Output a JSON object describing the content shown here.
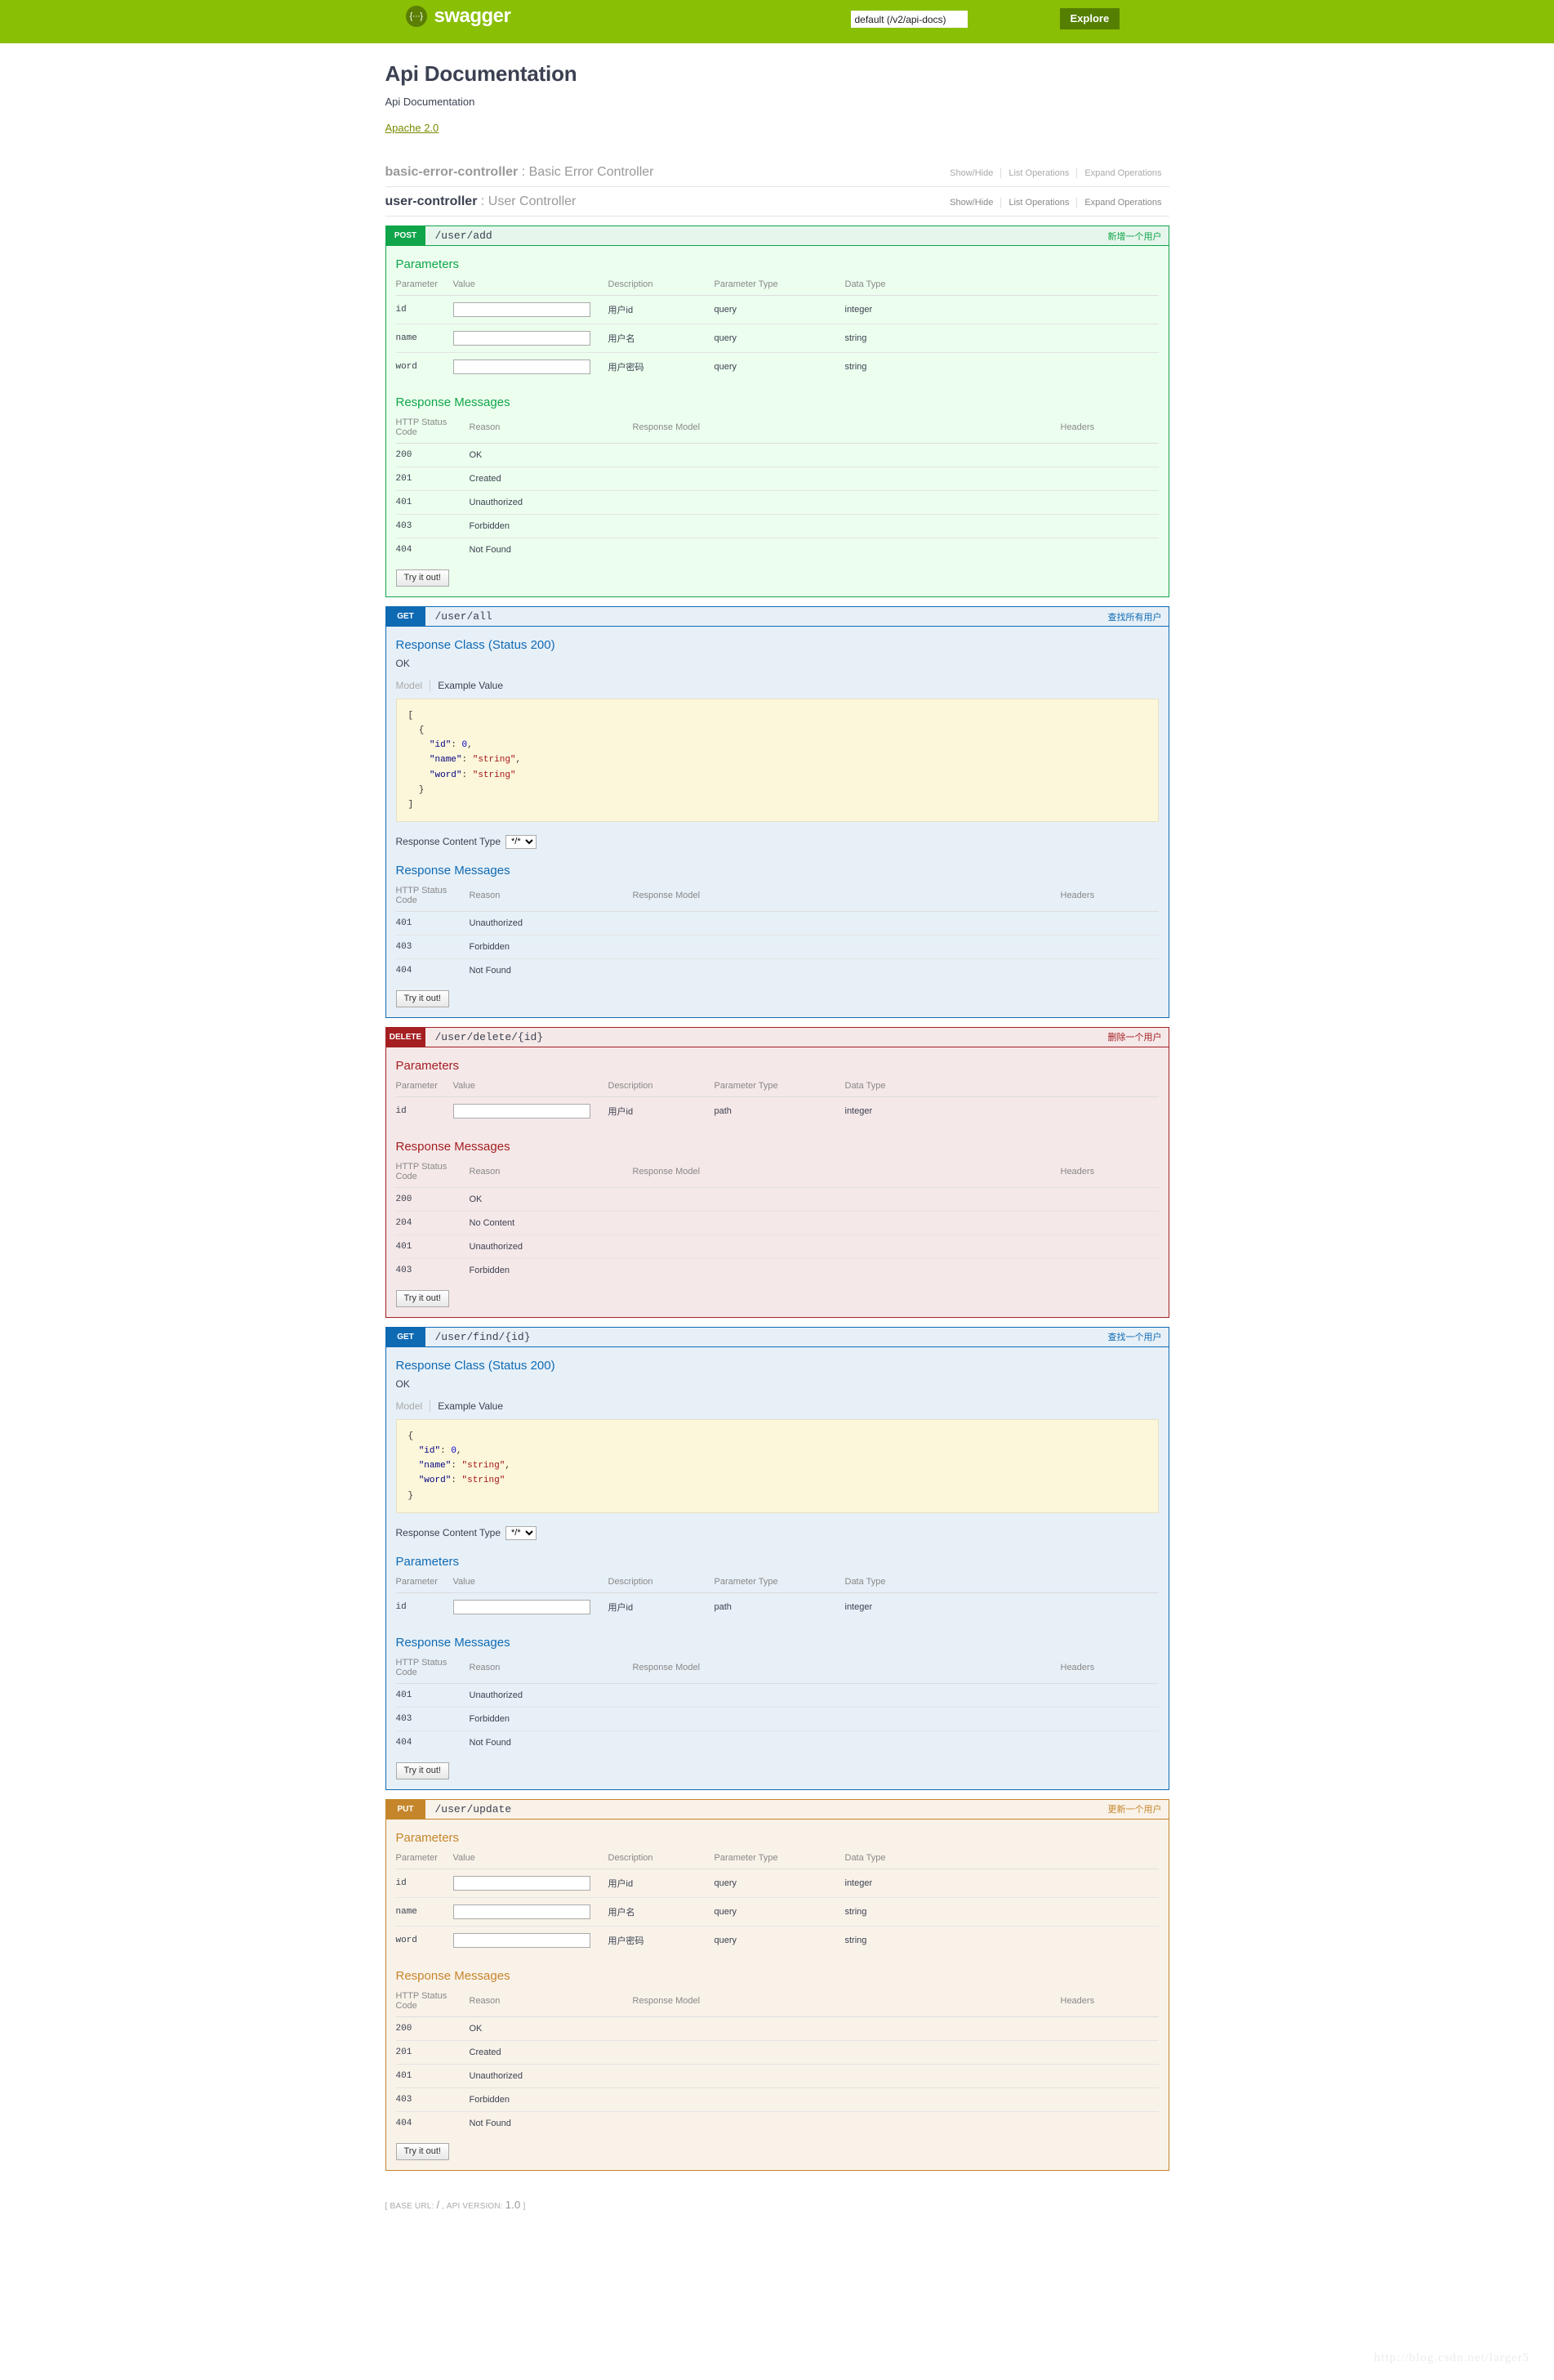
{
  "topbar": {
    "logo_text": "swagger",
    "logo_icon": "swagger-brace-icon",
    "url_value": "default (/v2/api-docs)",
    "url_placeholder": "http://example.com/api",
    "explore_label": "Explore",
    "bg_color": "#89bf04",
    "explore_color": "#547f00"
  },
  "info": {
    "title": "Api Documentation",
    "description": "Api Documentation",
    "license": "Apache 2.0"
  },
  "resource_options": {
    "show_hide": "Show/Hide",
    "list_operations": "List Operations",
    "expand_operations": "Expand Operations"
  },
  "resources": [
    {
      "name": "basic-error-controller",
      "separator": ":",
      "description": "Basic Error Controller",
      "active": false
    },
    {
      "name": "user-controller",
      "separator": ":",
      "description": "User Controller",
      "active": true
    }
  ],
  "labels": {
    "parameters": "Parameters",
    "response_messages": "Response Messages",
    "response_class": "Response Class (Status 200)",
    "response_class_desc": "OK",
    "model_tab": "Model",
    "example_tab": "Example Value",
    "response_content_type": "Response Content Type",
    "content_type_value": "*/*",
    "try_it_out": "Try it out!",
    "param_headers": [
      "Parameter",
      "Value",
      "Description",
      "Parameter Type",
      "Data Type"
    ],
    "response_headers": [
      "HTTP Status Code",
      "Reason",
      "Response Model",
      "Headers"
    ]
  },
  "operations": [
    {
      "method": "POST",
      "method_class": "post",
      "path": "/user/add",
      "summary": "新增一个用户",
      "has_response_class": false,
      "parameters": [
        {
          "name": "id",
          "value": "",
          "description": "用户id",
          "param_type": "query",
          "data_type": "integer"
        },
        {
          "name": "name",
          "value": "",
          "description": "用户名",
          "param_type": "query",
          "data_type": "string"
        },
        {
          "name": "word",
          "value": "",
          "description": "用户密码",
          "param_type": "query",
          "data_type": "string"
        }
      ],
      "responses": [
        {
          "code": "200",
          "reason": "OK",
          "model": "",
          "headers": ""
        },
        {
          "code": "201",
          "reason": "Created",
          "model": "",
          "headers": ""
        },
        {
          "code": "401",
          "reason": "Unauthorized",
          "model": "",
          "headers": ""
        },
        {
          "code": "403",
          "reason": "Forbidden",
          "model": "",
          "headers": ""
        },
        {
          "code": "404",
          "reason": "Not Found",
          "model": "",
          "headers": ""
        }
      ]
    },
    {
      "method": "GET",
      "method_class": "get",
      "path": "/user/all",
      "summary": "查找所有用户",
      "has_response_class": true,
      "example_value": "[\n  {\n    \"id\": 0,\n    \"name\": \"string\",\n    \"word\": \"string\"\n  }\n]",
      "parameters": [],
      "responses": [
        {
          "code": "401",
          "reason": "Unauthorized",
          "model": "",
          "headers": ""
        },
        {
          "code": "403",
          "reason": "Forbidden",
          "model": "",
          "headers": ""
        },
        {
          "code": "404",
          "reason": "Not Found",
          "model": "",
          "headers": ""
        }
      ]
    },
    {
      "method": "DELETE",
      "method_class": "delete",
      "path": "/user/delete/{id}",
      "summary": "删除一个用户",
      "has_response_class": false,
      "parameters": [
        {
          "name": "id",
          "value": "",
          "description": "用户id",
          "param_type": "path",
          "data_type": "integer"
        }
      ],
      "responses": [
        {
          "code": "200",
          "reason": "OK",
          "model": "",
          "headers": ""
        },
        {
          "code": "204",
          "reason": "No Content",
          "model": "",
          "headers": ""
        },
        {
          "code": "401",
          "reason": "Unauthorized",
          "model": "",
          "headers": ""
        },
        {
          "code": "403",
          "reason": "Forbidden",
          "model": "",
          "headers": ""
        }
      ]
    },
    {
      "method": "GET",
      "method_class": "get",
      "path": "/user/find/{id}",
      "summary": "查找一个用户",
      "has_response_class": true,
      "example_value": "{\n  \"id\": 0,\n  \"name\": \"string\",\n  \"word\": \"string\"\n}",
      "parameters": [
        {
          "name": "id",
          "value": "",
          "description": "用户id",
          "param_type": "path",
          "data_type": "integer"
        }
      ],
      "responses": [
        {
          "code": "401",
          "reason": "Unauthorized",
          "model": "",
          "headers": ""
        },
        {
          "code": "403",
          "reason": "Forbidden",
          "model": "",
          "headers": ""
        },
        {
          "code": "404",
          "reason": "Not Found",
          "model": "",
          "headers": ""
        }
      ]
    },
    {
      "method": "PUT",
      "method_class": "put",
      "path": "/user/update",
      "summary": "更新一个用户",
      "has_response_class": false,
      "parameters": [
        {
          "name": "id",
          "value": "",
          "description": "用户id",
          "param_type": "query",
          "data_type": "integer"
        },
        {
          "name": "name",
          "value": "",
          "description": "用户名",
          "param_type": "query",
          "data_type": "string"
        },
        {
          "name": "word",
          "value": "",
          "description": "用户密码",
          "param_type": "query",
          "data_type": "string"
        }
      ],
      "responses": [
        {
          "code": "200",
          "reason": "OK",
          "model": "",
          "headers": ""
        },
        {
          "code": "201",
          "reason": "Created",
          "model": "",
          "headers": ""
        },
        {
          "code": "401",
          "reason": "Unauthorized",
          "model": "",
          "headers": ""
        },
        {
          "code": "403",
          "reason": "Forbidden",
          "model": "",
          "headers": ""
        },
        {
          "code": "404",
          "reason": "Not Found",
          "model": "",
          "headers": ""
        }
      ]
    }
  ],
  "footer": {
    "base_url_label": "BASE URL:",
    "base_url_value": "/",
    "comma": ",",
    "api_version_label": "API VERSION:",
    "api_version_value": "1.0",
    "open_bracket": "[",
    "close_bracket": "]"
  },
  "watermark": "http://blog.csdn.net/larger5"
}
